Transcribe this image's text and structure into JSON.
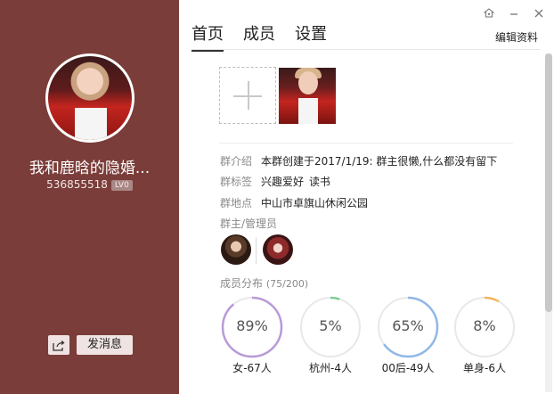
{
  "group": {
    "name": "我和鹿晗的隐婚...",
    "id": "536855518",
    "level": "LV0",
    "send_message_label": "发消息"
  },
  "tabs": [
    {
      "label": "首页",
      "active": true
    },
    {
      "label": "成员",
      "active": false
    },
    {
      "label": "设置",
      "active": false
    }
  ],
  "header": {
    "edit_label": "编辑资料",
    "icons": [
      "pin-icon",
      "minimize-icon",
      "close-icon"
    ]
  },
  "info": {
    "intro_label": "群介绍",
    "intro_value": "本群创建于2017/1/19: 群主很懒,什么都没有留下",
    "tags_label": "群标签",
    "tags": [
      "兴趣爱好",
      "读书"
    ],
    "location_label": "群地点",
    "location_value": "中山市卓旗山休闲公园"
  },
  "admins": {
    "title": "群主/管理员"
  },
  "members": {
    "title": "成员分布",
    "count": "(75/200)",
    "stats": [
      {
        "percent": "89%",
        "value": 0.89,
        "label": "女-67人",
        "color": "#b89ad8"
      },
      {
        "percent": "5%",
        "value": 0.05,
        "label": "杭州-4人",
        "color": "#7fcf94"
      },
      {
        "percent": "65%",
        "value": 0.65,
        "label": "00后-49人",
        "color": "#8fb8e6"
      },
      {
        "percent": "8%",
        "value": 0.08,
        "label": "单身-6人",
        "color": "#f3b65c"
      }
    ]
  },
  "colors": {
    "sidebar_bg": "#7b3d3a",
    "ring_track": "#e8e8e8"
  }
}
